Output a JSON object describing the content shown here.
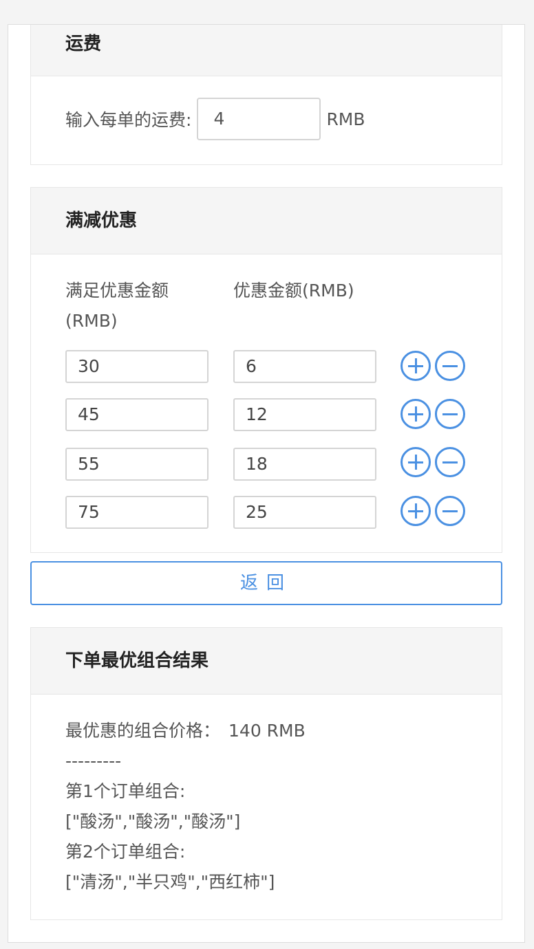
{
  "shipping": {
    "title": "运费",
    "label": "输入每单的运费:",
    "value": "4",
    "unit": "RMB"
  },
  "discount": {
    "title": "满减优惠",
    "col_threshold": "满足优惠金额",
    "col_threshold_unit": "(RMB)",
    "col_amount": "优惠金额(RMB)",
    "tiers": [
      {
        "threshold": "30",
        "amount": "6"
      },
      {
        "threshold": "45",
        "amount": "12"
      },
      {
        "threshold": "55",
        "amount": "18"
      },
      {
        "threshold": "75",
        "amount": "25"
      }
    ]
  },
  "back_label": "返回",
  "result": {
    "title": "下单最优组合结果",
    "price_label": "最优惠的组合价格：",
    "price_value": "140 RMB",
    "separator": "---------",
    "orders": [
      {
        "label": "第1个订单组合:",
        "items": "[\"酸汤\",\"酸汤\",\"酸汤\"]"
      },
      {
        "label": "第2个订单组合:",
        "items": "[\"清汤\",\"半只鸡\",\"西红柿\"]"
      }
    ]
  },
  "colors": {
    "accent": "#4a90e2",
    "header_bg": "#f5f5f5",
    "border": "#e6e6e6"
  }
}
